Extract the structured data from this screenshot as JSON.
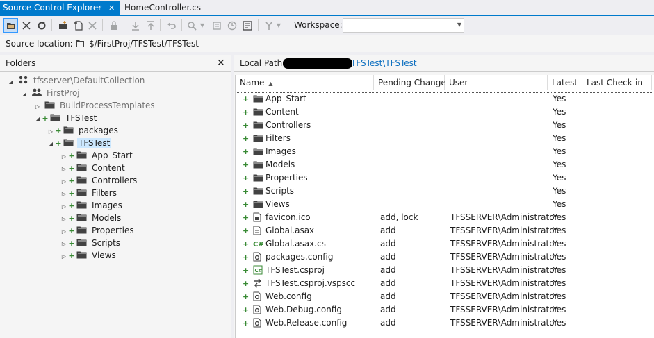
{
  "tabs": [
    {
      "label": "Source Control Explorer",
      "pin": "⊣",
      "close": "✕"
    },
    {
      "label": "HomeController.cs"
    }
  ],
  "toolbar": {
    "workspace_label": "Workspace:",
    "workspace_value": ""
  },
  "source_location": {
    "label": "Source location:",
    "path": "$/FirstProj/TFSTest/TFSTest"
  },
  "folders_pane": {
    "title": "Folders",
    "close": "✕",
    "tree": [
      {
        "label": "tfsserver\\DefaultCollection",
        "icon": "collection-icon",
        "level": 0,
        "expander": "expanded",
        "muted": true,
        "plus": false
      },
      {
        "label": "FirstProj",
        "icon": "team-project-icon",
        "level": 1,
        "expander": "expanded",
        "muted": true,
        "plus": false
      },
      {
        "label": "BuildProcessTemplates",
        "icon": "folder-icon",
        "level": 2,
        "expander": "collapsed",
        "muted": true,
        "plus": false
      },
      {
        "label": "TFSTest",
        "icon": "folder-icon",
        "level": 2,
        "expander": "expanded",
        "muted": false,
        "plus": true
      },
      {
        "label": "packages",
        "icon": "folder-icon",
        "level": 3,
        "expander": "collapsed",
        "muted": false,
        "plus": true
      },
      {
        "label": "TFSTest",
        "icon": "folder-icon",
        "level": 3,
        "expander": "expanded",
        "muted": false,
        "plus": true,
        "selected": true
      },
      {
        "label": "App_Start",
        "icon": "folder-icon",
        "level": 4,
        "expander": "collapsed",
        "muted": false,
        "plus": true
      },
      {
        "label": "Content",
        "icon": "folder-icon",
        "level": 4,
        "expander": "collapsed",
        "muted": false,
        "plus": true
      },
      {
        "label": "Controllers",
        "icon": "folder-icon",
        "level": 4,
        "expander": "collapsed",
        "muted": false,
        "plus": true
      },
      {
        "label": "Filters",
        "icon": "folder-icon",
        "level": 4,
        "expander": "collapsed",
        "muted": false,
        "plus": true
      },
      {
        "label": "Images",
        "icon": "folder-icon",
        "level": 4,
        "expander": "collapsed",
        "muted": false,
        "plus": true
      },
      {
        "label": "Models",
        "icon": "folder-icon",
        "level": 4,
        "expander": "collapsed",
        "muted": false,
        "plus": true
      },
      {
        "label": "Properties",
        "icon": "folder-icon",
        "level": 4,
        "expander": "collapsed",
        "muted": false,
        "plus": true
      },
      {
        "label": "Scripts",
        "icon": "folder-icon",
        "level": 4,
        "expander": "collapsed",
        "muted": false,
        "plus": true
      },
      {
        "label": "Views",
        "icon": "folder-icon",
        "level": 4,
        "expander": "collapsed",
        "muted": false,
        "plus": true
      }
    ]
  },
  "local_path": {
    "label": "Local Path:",
    "link": "TFSTest\\TFSTest"
  },
  "file_list": {
    "columns": [
      "Name",
      "Pending Change",
      "User",
      "Latest",
      "Last Check-in"
    ],
    "rows": [
      {
        "name": "App_Start",
        "icon": "folder-icon",
        "pending": "",
        "user": "",
        "latest": "Yes",
        "focused": true
      },
      {
        "name": "Content",
        "icon": "folder-icon",
        "pending": "",
        "user": "",
        "latest": "Yes"
      },
      {
        "name": "Controllers",
        "icon": "folder-icon",
        "pending": "",
        "user": "",
        "latest": "Yes"
      },
      {
        "name": "Filters",
        "icon": "folder-icon",
        "pending": "",
        "user": "",
        "latest": "Yes"
      },
      {
        "name": "Images",
        "icon": "folder-icon",
        "pending": "",
        "user": "",
        "latest": "Yes"
      },
      {
        "name": "Models",
        "icon": "folder-icon",
        "pending": "",
        "user": "",
        "latest": "Yes"
      },
      {
        "name": "Properties",
        "icon": "folder-icon",
        "pending": "",
        "user": "",
        "latest": "Yes"
      },
      {
        "name": "Scripts",
        "icon": "folder-icon",
        "pending": "",
        "user": "",
        "latest": "Yes"
      },
      {
        "name": "Views",
        "icon": "folder-icon",
        "pending": "",
        "user": "",
        "latest": "Yes"
      },
      {
        "name": "favicon.ico",
        "icon": "image-file-icon",
        "pending": "add, lock",
        "user": "TFSSERVER\\Administrator",
        "latest": "Yes"
      },
      {
        "name": "Global.asax",
        "icon": "asax-file-icon",
        "pending": "add",
        "user": "TFSSERVER\\Administrator",
        "latest": "Yes"
      },
      {
        "name": "Global.asax.cs",
        "icon": "csharp-file-icon",
        "pending": "add",
        "user": "TFSSERVER\\Administrator",
        "latest": "Yes"
      },
      {
        "name": "packages.config",
        "icon": "config-file-icon",
        "pending": "add",
        "user": "TFSSERVER\\Administrator",
        "latest": "Yes"
      },
      {
        "name": "TFSTest.csproj",
        "icon": "csproj-file-icon",
        "pending": "add",
        "user": "TFSSERVER\\Administrator",
        "latest": "Yes"
      },
      {
        "name": "TFSTest.csproj.vspscc",
        "icon": "vspscc-file-icon",
        "pending": "add",
        "user": "TFSSERVER\\Administrator",
        "latest": "Yes"
      },
      {
        "name": "Web.config",
        "icon": "config-file-icon",
        "pending": "add",
        "user": "TFSSERVER\\Administrator",
        "latest": "Yes"
      },
      {
        "name": "Web.Debug.config",
        "icon": "config-file-icon",
        "pending": "add",
        "user": "TFSSERVER\\Administrator",
        "latest": "Yes"
      },
      {
        "name": "Web.Release.config",
        "icon": "config-file-icon",
        "pending": "add",
        "user": "TFSSERVER\\Administrator",
        "latest": "Yes"
      }
    ]
  },
  "colors": {
    "accent": "#007acc",
    "pending_plus": "#388a34",
    "link": "#0e70c0",
    "selection": "#cce8ff"
  }
}
